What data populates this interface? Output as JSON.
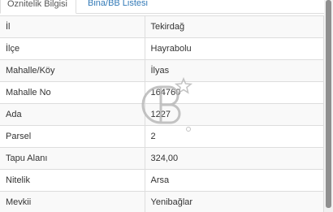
{
  "tabs": [
    {
      "label": "Öznitelik Bilgisi",
      "active": true
    },
    {
      "label": "Bina/BB Listesi",
      "active": false
    }
  ],
  "rows": [
    {
      "key": "İl",
      "value": "Tekirdağ"
    },
    {
      "key": "İlçe",
      "value": "Hayrabolu"
    },
    {
      "key": "Mahalle/Köy",
      "value": "İlyas"
    },
    {
      "key": "Mahalle No",
      "value": "164760"
    },
    {
      "key": "Ada",
      "value": "1227"
    },
    {
      "key": "Parsel",
      "value": "2"
    },
    {
      "key": "Tapu Alanı",
      "value": "324,00"
    },
    {
      "key": "Nitelik",
      "value": "Arsa"
    },
    {
      "key": "Mevkii",
      "value": "Yenibağlar"
    }
  ],
  "colors": {
    "link": "#337ab7",
    "border": "#dddddd",
    "stripe": "#f9f9f9",
    "watermark": "#b5b5b5"
  },
  "watermark_icon": "cb-logo-watermark-icon"
}
